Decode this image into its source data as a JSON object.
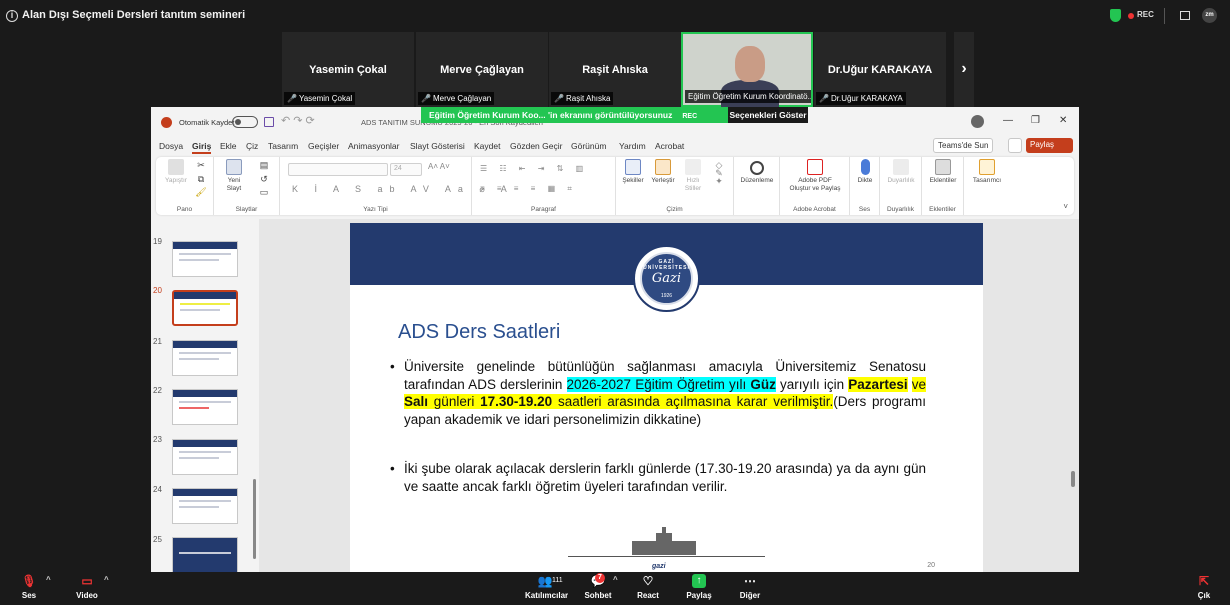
{
  "meeting": {
    "title": "Alan Dışı Seçmeli Dersleri tanıtım semineri",
    "rec_label": "REC"
  },
  "participants": [
    {
      "name": "Yasemin Çokal",
      "label": "Yasemin Çokal"
    },
    {
      "name": "Merve Çağlayan",
      "label": "Merve Çağlayan"
    },
    {
      "name": "Raşit Ahıska",
      "label": "Raşit Ahıska"
    },
    {
      "name": "",
      "label": "Eğitim Öğretim Kurum Koordinatö..."
    },
    {
      "name": "Dr.Uğur KARAKAYA",
      "label": "Dr.Uğur KARAKAYA"
    }
  ],
  "share": {
    "banner": "Eğitim Öğretim Kurum Koo... 'in ekranını görüntülüyorsunuz",
    "rec": "REC",
    "options": "Seçenekleri Göster"
  },
  "ppt": {
    "autosave_label": "Otomatik Kaydet",
    "doc_title": "ADS TANITIM SUNUMU 2025-26 - En Son Kaydedilen",
    "menu": [
      "Dosya",
      "Giriş",
      "Ekle",
      "Çiz",
      "Tasarım",
      "Geçişler",
      "Animasyonlar",
      "Slayt Gösterisi",
      "Kaydet",
      "Gözden Geçir",
      "Görünüm",
      "Yardım",
      "Acrobat"
    ],
    "teams_label": "Teams'de Sun",
    "share_label": "Paylaş",
    "ribbon": {
      "paste": "Yapıştır",
      "new_slide_1": "Yeni",
      "new_slide_2": "Slayt",
      "font_size": "24",
      "shapes": "Şekiller",
      "arrange": "Yerleştir",
      "quick_1": "Hızlı",
      "quick_2": "Stiller",
      "edit": "Düzenleme",
      "pdf_1": "Adobe PDF",
      "pdf_2": "Oluştur ve Paylaş",
      "dictate": "Dikte",
      "sensitivity": "Duyarlılık",
      "addins": "Eklentiler",
      "designer": "Tasarımcı",
      "groups": [
        "Pano",
        "Slaytlar",
        "Yazı Tipi",
        "Paragraf",
        "Çizim",
        "Adobe Acrobat",
        "Ses",
        "Duyarlılık",
        "Eklentiler"
      ]
    },
    "thumb_numbers": [
      "19",
      "20",
      "21",
      "22",
      "23",
      "24",
      "25"
    ],
    "selected_slide": "20",
    "slide": {
      "seal_ring": "GAZİ ÜNİVERSİTESİ",
      "seal_name": "Gazi",
      "seal_year": "1926",
      "title": "ADS Ders Saatleri",
      "b1_a": "Üniversite genelinde bütünlüğün sağlanması amacıyla Üniversitemiz Senatosu tarafından ADS derslerinin ",
      "b1_hl1": "2026-2027 Eğitim Öğretim yılı ",
      "b1_hl1b": "Güz",
      "b1_b": " yarıyılı için ",
      "b1_hl2": "Pazartesi",
      "b1_hl3": "ve ",
      "b1_hl3b": "Salı",
      "b1_hl4": " günleri ",
      "b1_hl4b": "17.30-19.20",
      "b1_hl5": " saatleri arasında açılmasına karar verilmiştir.",
      "b1_c": "(Ders programı yapan akademik ve idari personelimizin dikkatine)",
      "b2": "İki şube olarak açılacak derslerin farklı günlerde (17.30-19.20 arasında) ya da aynı gün ve saatte ancak farklı öğretim üyeleri tarafından verilir.",
      "footer_logo": "gazi",
      "number": "20"
    }
  },
  "toolbar": {
    "audio": "Ses",
    "video": "Video",
    "participants": "Katılımcılar",
    "participants_count": "111",
    "chat": "Sohbet",
    "chat_badge": "7",
    "react": "React",
    "share": "Paylaş",
    "more": "Diğer",
    "leave": "Çık"
  }
}
